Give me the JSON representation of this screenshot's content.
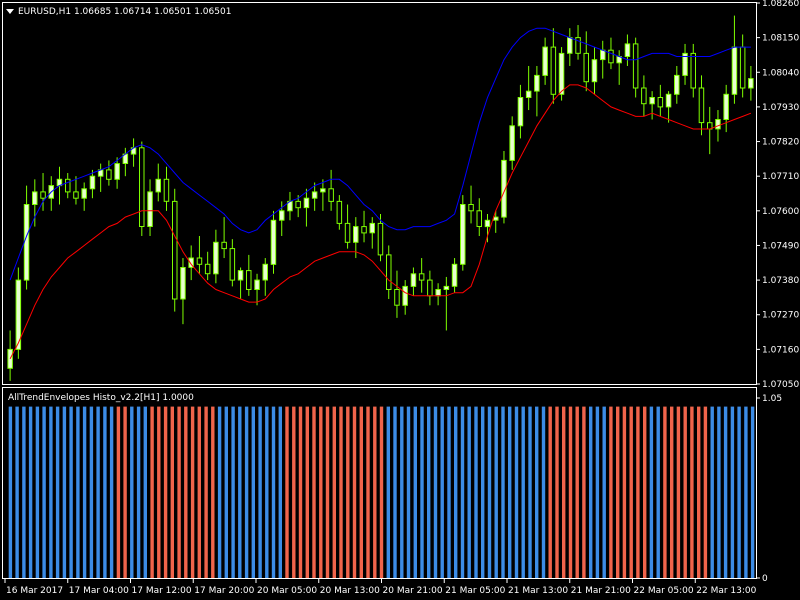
{
  "header": {
    "symbol_line": "EURUSD,H1  1.06685 1.06714 1.06501 1.06501",
    "indicator_line": "AllTrendEnvelopes Histo_v2.2[H1] 1.0000"
  },
  "colors": {
    "background": "#000000",
    "frame": "#ffffff",
    "bull_candle": "#e8ffd0",
    "bear_candle": "#000000",
    "wick": "#7fff00",
    "upper_envelope": "#0000ff",
    "lower_envelope": "#ff0000",
    "histo_blue": "#3c8ce6",
    "histo_red": "#f0644b"
  },
  "chart_data": [
    {
      "type": "candlestick",
      "symbol": "EURUSD",
      "timeframe": "H1",
      "ylim": [
        1.0705,
        1.0826
      ],
      "y_ticks": [
        "1.08260",
        "1.08150",
        "1.08040",
        "1.07930",
        "1.07820",
        "1.07710",
        "1.07600",
        "1.07490",
        "1.07380",
        "1.07270",
        "1.07160",
        "1.07050"
      ],
      "x_ticks": [
        "16 Mar 2017",
        "17 Mar 04:00",
        "17 Mar 12:00",
        "17 Mar 20:00",
        "20 Mar 05:00",
        "20 Mar 13:00",
        "20 Mar 21:00",
        "21 Mar 05:00",
        "21 Mar 13:00",
        "21 Mar 21:00",
        "22 Mar 05:00",
        "22 Mar 13:00"
      ],
      "candles": [
        [
          1.071,
          1.0722,
          1.0706,
          1.0716
        ],
        [
          1.0716,
          1.0742,
          1.0713,
          1.0738
        ],
        [
          1.0738,
          1.0768,
          1.0735,
          1.0762
        ],
        [
          1.0762,
          1.077,
          1.0755,
          1.0766
        ],
        [
          1.0766,
          1.0772,
          1.076,
          1.0764
        ],
        [
          1.0764,
          1.0771,
          1.076,
          1.0768
        ],
        [
          1.0768,
          1.0774,
          1.0762,
          1.077
        ],
        [
          1.077,
          1.0772,
          1.0764,
          1.0766
        ],
        [
          1.0766,
          1.0771,
          1.0762,
          1.0764
        ],
        [
          1.0764,
          1.0769,
          1.076,
          1.0767
        ],
        [
          1.0767,
          1.0773,
          1.0764,
          1.0771
        ],
        [
          1.0771,
          1.0775,
          1.0766,
          1.0773
        ],
        [
          1.0773,
          1.0776,
          1.0768,
          1.077
        ],
        [
          1.077,
          1.0777,
          1.0767,
          1.0775
        ],
        [
          1.0775,
          1.078,
          1.0771,
          1.0778
        ],
        [
          1.0778,
          1.0783,
          1.0774,
          1.078
        ],
        [
          1.078,
          1.0782,
          1.0752,
          1.0755
        ],
        [
          1.0755,
          1.077,
          1.0752,
          1.0766
        ],
        [
          1.0766,
          1.0775,
          1.0763,
          1.077
        ],
        [
          1.077,
          1.0774,
          1.076,
          1.0763
        ],
        [
          1.0763,
          1.0767,
          1.0728,
          1.0732
        ],
        [
          1.0732,
          1.0745,
          1.0724,
          1.0742
        ],
        [
          1.0742,
          1.0749,
          1.0738,
          1.0745
        ],
        [
          1.0745,
          1.0752,
          1.074,
          1.0743
        ],
        [
          1.0743,
          1.0747,
          1.0738,
          1.074
        ],
        [
          1.074,
          1.0754,
          1.0737,
          1.075
        ],
        [
          1.075,
          1.0758,
          1.0745,
          1.0748
        ],
        [
          1.0748,
          1.0751,
          1.0736,
          1.0738
        ],
        [
          1.0738,
          1.0742,
          1.0732,
          1.0741
        ],
        [
          1.0741,
          1.0746,
          1.0733,
          1.0735
        ],
        [
          1.0735,
          1.074,
          1.073,
          1.0738
        ],
        [
          1.0738,
          1.0745,
          1.0733,
          1.0743
        ],
        [
          1.0743,
          1.076,
          1.074,
          1.0757
        ],
        [
          1.0757,
          1.0763,
          1.0752,
          1.076
        ],
        [
          1.076,
          1.0766,
          1.0757,
          1.0763
        ],
        [
          1.0763,
          1.0765,
          1.0758,
          1.0761
        ],
        [
          1.0761,
          1.0767,
          1.0755,
          1.0764
        ],
        [
          1.0764,
          1.0769,
          1.076,
          1.0766
        ],
        [
          1.0766,
          1.077,
          1.076,
          1.0767
        ],
        [
          1.0767,
          1.0773,
          1.076,
          1.0763
        ],
        [
          1.0763,
          1.0765,
          1.0754,
          1.0756
        ],
        [
          1.0756,
          1.0762,
          1.0748,
          1.075
        ],
        [
          1.075,
          1.0758,
          1.0745,
          1.0755
        ],
        [
          1.0755,
          1.076,
          1.075,
          1.0753
        ],
        [
          1.0753,
          1.0758,
          1.0748,
          1.0756
        ],
        [
          1.0756,
          1.0759,
          1.0744,
          1.0746
        ],
        [
          1.0746,
          1.0749,
          1.0732,
          1.0735
        ],
        [
          1.0735,
          1.0741,
          1.0726,
          1.073
        ],
        [
          1.073,
          1.0738,
          1.0727,
          1.0736
        ],
        [
          1.0736,
          1.0742,
          1.0733,
          1.074
        ],
        [
          1.074,
          1.0745,
          1.0734,
          1.0738
        ],
        [
          1.0738,
          1.0741,
          1.073,
          1.0733
        ],
        [
          1.0733,
          1.0737,
          1.073,
          1.0735
        ],
        [
          1.0735,
          1.0739,
          1.0722,
          1.0736
        ],
        [
          1.0736,
          1.0745,
          1.0734,
          1.0743
        ],
        [
          1.0743,
          1.0765,
          1.0741,
          1.0762
        ],
        [
          1.0762,
          1.0768,
          1.0756,
          1.076
        ],
        [
          1.076,
          1.0764,
          1.0752,
          1.0755
        ],
        [
          1.0755,
          1.0759,
          1.075,
          1.0757
        ],
        [
          1.0757,
          1.076,
          1.0753,
          1.0758
        ],
        [
          1.0758,
          1.0779,
          1.0756,
          1.0776
        ],
        [
          1.0776,
          1.079,
          1.0773,
          1.0787
        ],
        [
          1.0787,
          1.08,
          1.0783,
          1.0796
        ],
        [
          1.0796,
          1.0806,
          1.0792,
          1.0798
        ],
        [
          1.0798,
          1.0806,
          1.079,
          1.0803
        ],
        [
          1.0803,
          1.0815,
          1.08,
          1.0812
        ],
        [
          1.0812,
          1.0818,
          1.0794,
          1.0797
        ],
        [
          1.0797,
          1.0812,
          1.0795,
          1.081
        ],
        [
          1.081,
          1.0818,
          1.0806,
          1.0815
        ],
        [
          1.0815,
          1.0819,
          1.0808,
          1.081
        ],
        [
          1.081,
          1.0817,
          1.0798,
          1.0801
        ],
        [
          1.0801,
          1.0812,
          1.0797,
          1.0808
        ],
        [
          1.0808,
          1.0814,
          1.0802,
          1.0811
        ],
        [
          1.0811,
          1.0815,
          1.0805,
          1.0807
        ],
        [
          1.0807,
          1.0811,
          1.08,
          1.0809
        ],
        [
          1.0809,
          1.0816,
          1.0806,
          1.0813
        ],
        [
          1.0813,
          1.0815,
          1.0796,
          1.0799
        ],
        [
          1.0799,
          1.0803,
          1.079,
          1.0794
        ],
        [
          1.0794,
          1.0798,
          1.0789,
          1.0796
        ],
        [
          1.0796,
          1.08,
          1.079,
          1.0793
        ],
        [
          1.0793,
          1.0798,
          1.0788,
          1.0797
        ],
        [
          1.0797,
          1.0806,
          1.0794,
          1.0803
        ],
        [
          1.0803,
          1.0813,
          1.08,
          1.081
        ],
        [
          1.081,
          1.0813,
          1.0796,
          1.0799
        ],
        [
          1.0799,
          1.0803,
          1.0784,
          1.0788
        ],
        [
          1.0788,
          1.0793,
          1.0778,
          1.0786
        ],
        [
          1.0786,
          1.0792,
          1.0782,
          1.0789
        ],
        [
          1.0789,
          1.08,
          1.0785,
          1.0797
        ],
        [
          1.0797,
          1.0822,
          1.0794,
          1.0812
        ],
        [
          1.0812,
          1.0816,
          1.0796,
          1.0799
        ],
        [
          1.0799,
          1.0806,
          1.0795,
          1.0802
        ]
      ],
      "upper_envelope": [
        1.0738,
        1.0745,
        1.0752,
        1.0758,
        1.0763,
        1.0766,
        1.0768,
        1.0769,
        1.077,
        1.0771,
        1.0772,
        1.0773,
        1.0774,
        1.0776,
        1.0778,
        1.078,
        1.0781,
        1.078,
        1.0778,
        1.0775,
        1.0772,
        1.0769,
        1.0767,
        1.0765,
        1.0763,
        1.0761,
        1.0759,
        1.0756,
        1.0754,
        1.0753,
        1.0754,
        1.0757,
        1.0759,
        1.0761,
        1.0763,
        1.0764,
        1.0766,
        1.0768,
        1.0769,
        1.077,
        1.077,
        1.0768,
        1.0765,
        1.0762,
        1.076,
        1.0757,
        1.0755,
        1.0754,
        1.0754,
        1.0755,
        1.0755,
        1.0755,
        1.0756,
        1.0757,
        1.0759,
        1.0768,
        1.0778,
        1.0788,
        1.0796,
        1.0802,
        1.0808,
        1.0812,
        1.0815,
        1.0817,
        1.0818,
        1.0818,
        1.0817,
        1.0816,
        1.0815,
        1.0814,
        1.0813,
        1.0812,
        1.0811,
        1.081,
        1.0809,
        1.0808,
        1.0808,
        1.0809,
        1.081,
        1.081,
        1.081,
        1.0809,
        1.0809,
        1.0809,
        1.0809,
        1.0809,
        1.081,
        1.0811,
        1.0812,
        1.0812,
        1.0812
      ],
      "lower_envelope": [
        1.0713,
        1.0718,
        1.0724,
        1.073,
        1.0735,
        1.0739,
        1.0742,
        1.0745,
        1.0747,
        1.0749,
        1.0751,
        1.0753,
        1.0755,
        1.0756,
        1.0758,
        1.0759,
        1.076,
        1.076,
        1.076,
        1.0757,
        1.0752,
        1.0747,
        1.0743,
        1.074,
        1.0737,
        1.0735,
        1.0734,
        1.0733,
        1.0732,
        1.0731,
        1.0731,
        1.0732,
        1.0735,
        1.0737,
        1.0739,
        1.074,
        1.0742,
        1.0744,
        1.0745,
        1.0746,
        1.0747,
        1.0747,
        1.0747,
        1.0746,
        1.0744,
        1.0741,
        1.0738,
        1.0736,
        1.0734,
        1.0733,
        1.0733,
        1.0733,
        1.0733,
        1.0733,
        1.0734,
        1.0734,
        1.0736,
        1.0743,
        1.0752,
        1.076,
        1.0766,
        1.0772,
        1.0777,
        1.0782,
        1.0787,
        1.0791,
        1.0795,
        1.0798,
        1.08,
        1.08,
        1.0799,
        1.0797,
        1.0795,
        1.0793,
        1.0792,
        1.0791,
        1.079,
        1.079,
        1.0791,
        1.079,
        1.0789,
        1.0788,
        1.0787,
        1.0786,
        1.0786,
        1.0786,
        1.0787,
        1.0788,
        1.0789,
        1.079,
        1.0791
      ]
    },
    {
      "type": "histogram",
      "title": "AllTrendEnvelopes Histo_v2.2[H1] 1.0000",
      "ylim": [
        0,
        1.05
      ],
      "y_ticks": [
        "1.05",
        "0"
      ],
      "bar_value": 1.0,
      "trend": "BBBBBBBBBBBBBBBBRRBBBRRRRRRRRRRBBBBBBBBBBRRRRRRRRRRRRRRRBBBBBBBBBBBBBBBBBBBBBBBBRRRRRRBBBRRRRRRBBRRRRRRRBBBBBBB"
    }
  ]
}
